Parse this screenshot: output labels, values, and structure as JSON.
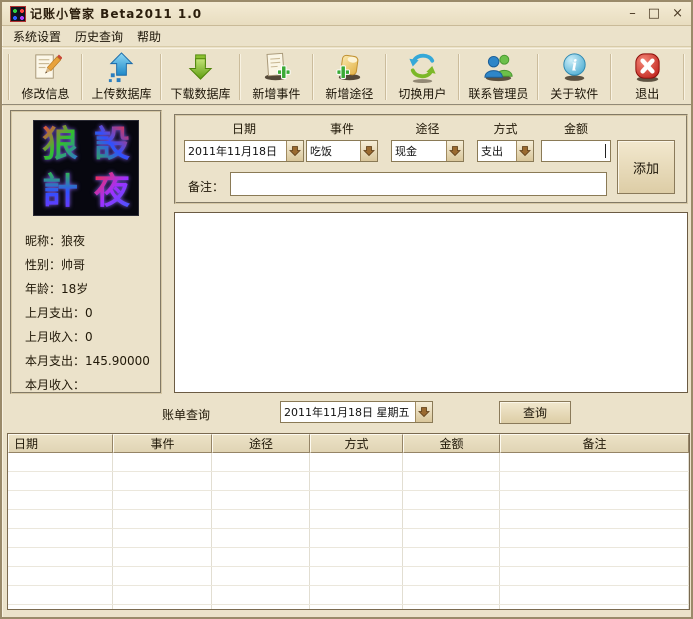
{
  "window": {
    "title": "记账小管家 Beta2011 1.0",
    "minimize_glyph": "–",
    "maximize_glyph": "□",
    "close_glyph": "×"
  },
  "menu": {
    "items": [
      {
        "label": "系统设置"
      },
      {
        "label": "历史查询"
      },
      {
        "label": "帮助"
      }
    ]
  },
  "toolbar": {
    "buttons": [
      {
        "label": "修改信息",
        "icon": "edit-icon"
      },
      {
        "label": "上传数据库",
        "icon": "upload-database-icon"
      },
      {
        "label": "下载数据库",
        "icon": "download-database-icon"
      },
      {
        "label": "新增事件",
        "icon": "add-event-icon"
      },
      {
        "label": "新增途径",
        "icon": "add-channel-icon"
      },
      {
        "label": "切换用户",
        "icon": "switch-user-icon"
      },
      {
        "label": "联系管理员",
        "icon": "contact-admin-icon"
      },
      {
        "label": "关于软件",
        "icon": "about-icon"
      },
      {
        "label": "退出",
        "icon": "exit-icon"
      }
    ]
  },
  "profile": {
    "avatar_chars": [
      "狼",
      "設",
      "計",
      "夜"
    ],
    "fields": [
      {
        "text": "昵称：狼夜"
      },
      {
        "text": "性别：帅哥"
      },
      {
        "text": "年龄：18岁"
      },
      {
        "text": "上月支出：0"
      },
      {
        "text": "上月收入：0"
      },
      {
        "text": "本月支出：145.90000"
      },
      {
        "text": "本月收入："
      }
    ]
  },
  "entry_form": {
    "column_labels": [
      "日期",
      "事件",
      "途径",
      "方式",
      "金额"
    ],
    "date": {
      "value": "2011年11月18日"
    },
    "event": {
      "value": "吃饭"
    },
    "channel": {
      "value": "现金"
    },
    "method": {
      "value": "支出"
    },
    "amount": {
      "value": ""
    },
    "note": {
      "label": "备注：",
      "value": ""
    },
    "add_button": "添加"
  },
  "query": {
    "label": "账单查询",
    "date_value": "2011年11月18日 星期五",
    "button": "查询"
  },
  "records_table": {
    "headers": [
      "日期",
      "事件",
      "途径",
      "方式",
      "金额",
      "备注"
    ],
    "rows": []
  },
  "theme": {
    "window_bg": "#EBE2CA",
    "combo_arrow_brown": "#8A5E2E",
    "header_bg": "#E7DDC2",
    "exit_red": "#C62A1E",
    "info_blue": "#49B2D8",
    "upload_blue": "#1E88C8",
    "download_green": "#6AA816"
  }
}
